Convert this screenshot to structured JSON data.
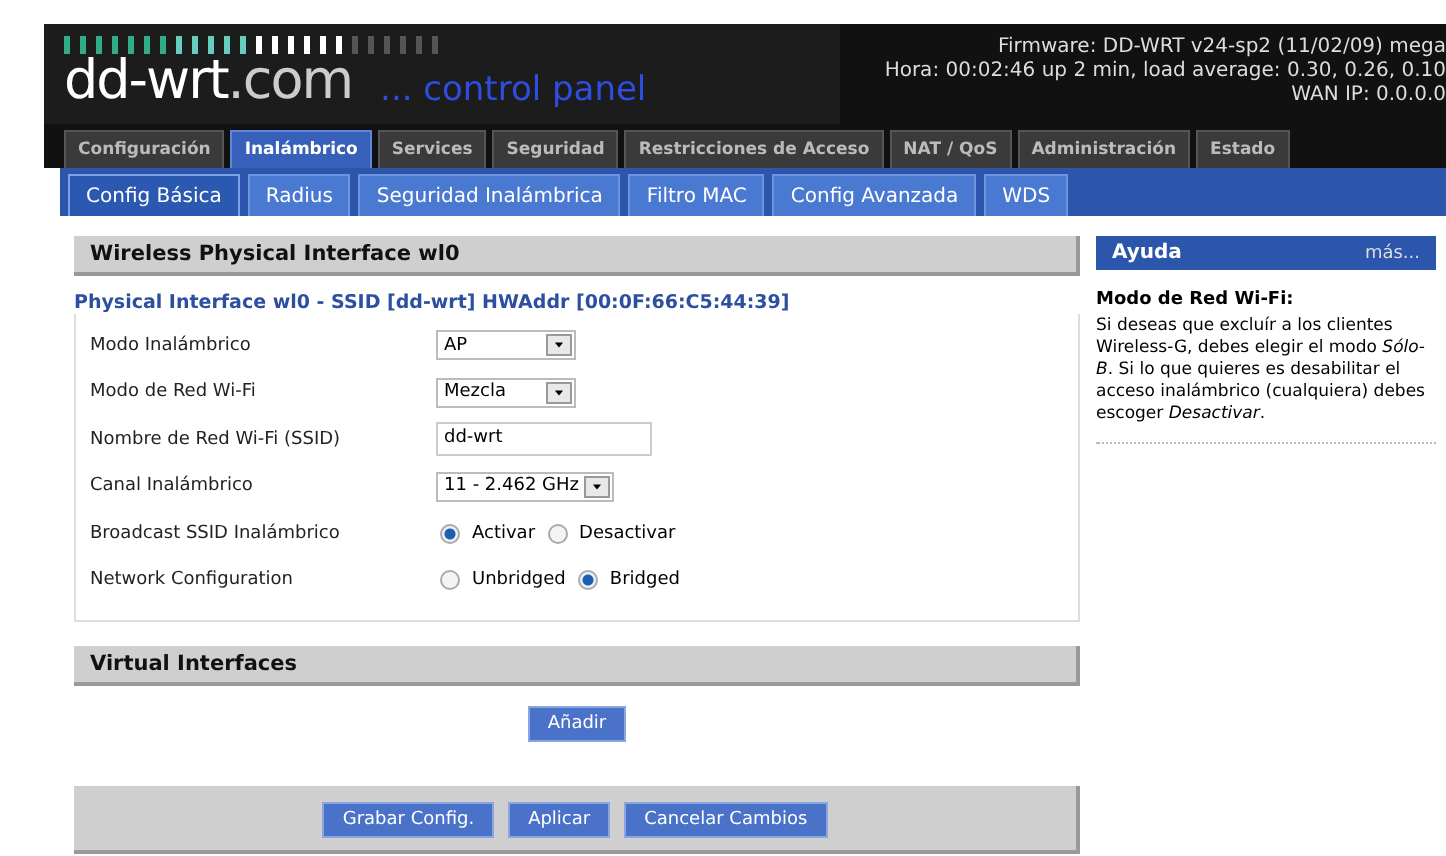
{
  "header": {
    "logo": "dd-wrt",
    "logo_suffix": ".com",
    "tagline": "... control panel",
    "info": [
      "Firmware: DD-WRT v24-sp2 (11/02/09) mega",
      "Hora: 00:02:46 up 2 min, load average: 0.30, 0.26, 0.10",
      "WAN IP: 0.0.0.0"
    ]
  },
  "tabs": [
    {
      "label": "Configuración",
      "selected": false
    },
    {
      "label": "Inalámbrico",
      "selected": true
    },
    {
      "label": "Services",
      "selected": false
    },
    {
      "label": "Seguridad",
      "selected": false
    },
    {
      "label": "Restricciones de Acceso",
      "selected": false
    },
    {
      "label": "NAT / QoS",
      "selected": false
    },
    {
      "label": "Administración",
      "selected": false
    },
    {
      "label": "Estado",
      "selected": false
    }
  ],
  "subtabs": [
    {
      "label": "Config Básica",
      "selected": true
    },
    {
      "label": "Radius",
      "selected": false
    },
    {
      "label": "Seguridad Inalámbrica",
      "selected": false
    },
    {
      "label": "Filtro MAC",
      "selected": false
    },
    {
      "label": "Config Avanzada",
      "selected": false
    },
    {
      "label": "WDS",
      "selected": false
    }
  ],
  "physical": {
    "title": "Wireless Physical Interface wl0",
    "legend": "Physical Interface wl0 - SSID [dd-wrt] HWAddr [00:0F:66:C5:44:39]",
    "rows": [
      {
        "kind": "select",
        "label": "Modo Inalámbrico",
        "value": "AP"
      },
      {
        "kind": "select",
        "label": "Modo de Red Wi-Fi",
        "value": "Mezcla"
      },
      {
        "kind": "text",
        "label": "Nombre de Red Wi-Fi (SSID)",
        "value": "dd-wrt"
      },
      {
        "kind": "select",
        "label": "Canal Inalámbrico",
        "value": "11 - 2.462 GHz"
      },
      {
        "kind": "radio",
        "label": "Broadcast SSID Inalámbrico",
        "options": [
          {
            "label": "Activar",
            "selected": true
          },
          {
            "label": "Desactivar",
            "selected": false
          }
        ]
      },
      {
        "kind": "radio",
        "label": "Network Configuration",
        "options": [
          {
            "label": "Unbridged",
            "selected": false
          },
          {
            "label": "Bridged",
            "selected": true
          }
        ]
      }
    ]
  },
  "virtual": {
    "title": "Virtual Interfaces",
    "add_button": "Añadir"
  },
  "actions": [
    "Grabar Config.",
    "Aplicar",
    "Cancelar Cambios"
  ],
  "help": {
    "title": "Ayuda",
    "more": "más...",
    "heading": "Modo de Red Wi-Fi:",
    "text": "Si deseas que excluír a los clientes Wireless-G, debes elegir el modo *Sólo-B*. Si lo que quieres es desabilitar el acceso inalámbrico (cualquiera) debes escoger *Desactivar*."
  }
}
